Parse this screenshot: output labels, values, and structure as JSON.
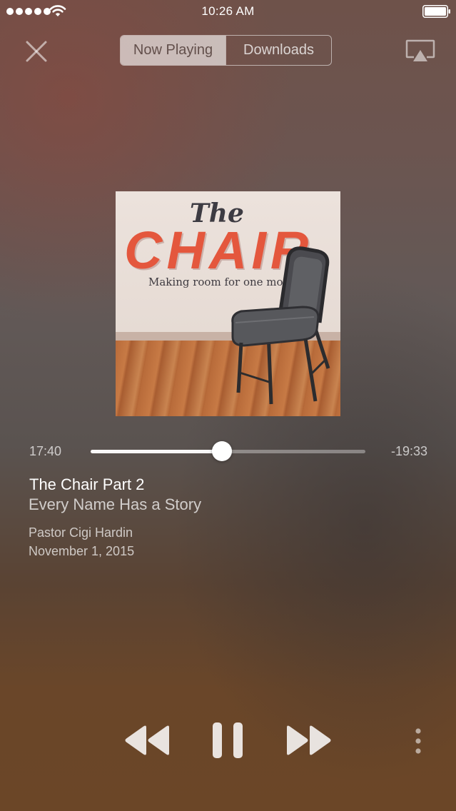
{
  "status_bar": {
    "time": "10:26 AM",
    "signal_bars": 5
  },
  "header": {
    "tabs": [
      {
        "label": "Now Playing",
        "active": true
      },
      {
        "label": "Downloads",
        "active": false
      }
    ]
  },
  "artwork": {
    "title_small": "The",
    "title_big": "CHAIR",
    "tagline": "Making room for one more..."
  },
  "player": {
    "elapsed": "17:40",
    "remaining": "-19:33",
    "progress_fraction": 0.478,
    "state": "playing"
  },
  "track": {
    "title": "The Chair Part 2",
    "subtitle": "Every Name Has a Story",
    "speaker": "Pastor Cigi Hardin",
    "date": "November 1, 2015"
  },
  "icons": {
    "close": "close-icon",
    "airplay": "airplay-icon",
    "rewind": "rewind-icon",
    "pause": "pause-icon",
    "forward": "fast-forward-icon",
    "more": "more-vertical-icon"
  },
  "colors": {
    "accent_text": "#ffffff",
    "title_red": "#e4573d"
  }
}
